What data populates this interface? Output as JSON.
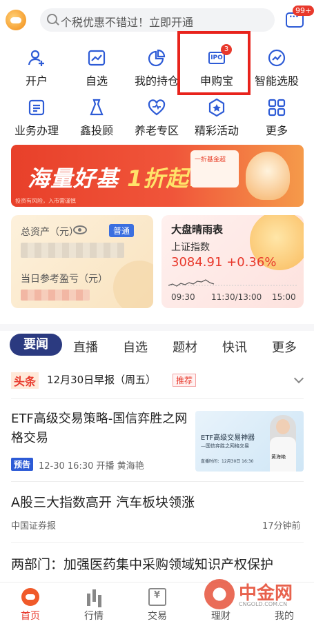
{
  "search": {
    "placeholder": "个税优惠不错过！立即开通"
  },
  "header": {
    "message_badge": "99+"
  },
  "quick_menu": [
    {
      "label": "开户",
      "icon": "add-user-icon"
    },
    {
      "label": "自选",
      "icon": "chart-icon"
    },
    {
      "label": "我的持仓",
      "icon": "pie-chart-icon"
    },
    {
      "label": "申购宝",
      "icon": "ipo-icon",
      "icon_text": "IPO",
      "badge": "3"
    },
    {
      "label": "智能选股",
      "icon": "smart-stock-icon"
    },
    {
      "label": "业务办理",
      "icon": "document-icon"
    },
    {
      "label": "鑫投顾",
      "icon": "advisor-icon"
    },
    {
      "label": "养老专区",
      "icon": "heart-icon"
    },
    {
      "label": "精彩活动",
      "icon": "star-icon"
    },
    {
      "label": "更多",
      "icon": "grid-icon"
    }
  ],
  "banner": {
    "title_a": "海量好基",
    "title_b": "1折起!",
    "card_label": "一折基金超",
    "note": "投资有风险，入市需谨慎"
  },
  "assets": {
    "total_label": "总资产（元）",
    "tag": "普通",
    "pnl_label": "当日参考盈亏（元）"
  },
  "market": {
    "title": "大盘晴雨表",
    "index_name": "上证指数",
    "value": "3084.91 +0.36%",
    "ticks": [
      "09:30",
      "11:30/13:00",
      "15:00"
    ]
  },
  "tabs": [
    "要闻",
    "直播",
    "自选",
    "题材",
    "快讯",
    "更多"
  ],
  "headline": {
    "tag": "头条",
    "text": "12月30日早报（周五）",
    "recommend": "推荐"
  },
  "news": [
    {
      "title": "ETF高级交易策略-国信弈胜之网格交易",
      "badge": "预告",
      "meta": "12-30 16:30 开播 黄海艳",
      "thumb_title": "ETF高级交易神器",
      "thumb_sub": "—国信弈胜之网格交易",
      "thumb_time": "直播时间：12月30日 16:30",
      "thumb_name": "黄海艳"
    },
    {
      "title": "A股三大指数高开 汽车板块领涨",
      "source": "中国证券报",
      "time": "17分钟前"
    },
    {
      "title": "两部门：加强医药集中采购领域知识产权保护"
    }
  ],
  "bottom_nav": [
    "首页",
    "行情",
    "交易",
    "理财",
    "我的"
  ],
  "watermark": {
    "name": "中金网",
    "url": "CNGOLD.COM.CN"
  },
  "colors": {
    "accent": "#e8392c",
    "primary": "#2d5bd6",
    "tab_active": "#2b3a80"
  }
}
